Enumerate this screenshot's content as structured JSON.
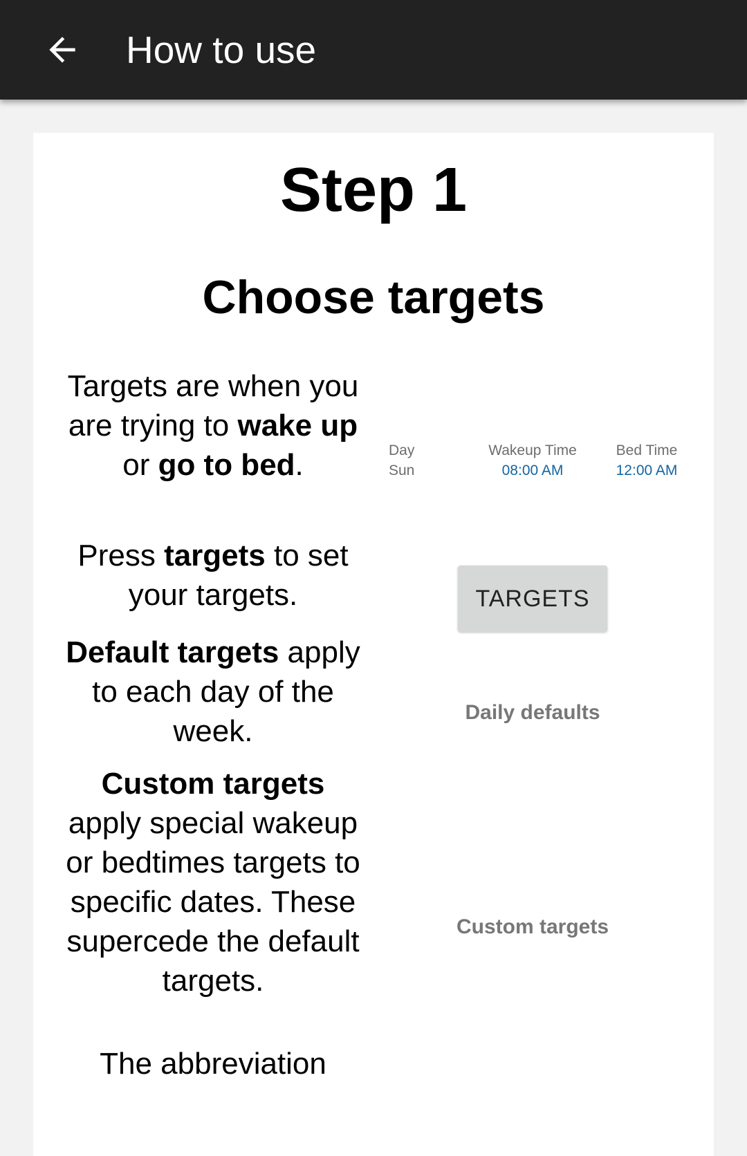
{
  "toolbar": {
    "title": "How to use",
    "back_icon": "arrow-left-icon"
  },
  "step": {
    "title": "Step 1",
    "subtitle": "Choose targets"
  },
  "paragraphs": {
    "p1": {
      "a": "Targets are when you are trying to ",
      "b1": "wake up",
      "c": " or ",
      "b2": "go to bed",
      "d": "."
    },
    "p2": {
      "a": "Press ",
      "b": "targets",
      "c": " to set your targets."
    },
    "p3": {
      "b": "Default targets",
      "c": " apply to each day of the week."
    },
    "p4": {
      "b": "Custom targets",
      "c": " apply special wakeup or bedtimes targets to specific dates. These supercede the default targets."
    },
    "p5": {
      "a": "The abbreviation"
    }
  },
  "preview": {
    "day_label": "Day",
    "day_value": "Sun",
    "wake_label": "Wakeup Time",
    "wake_value": "08:00 AM",
    "bed_label": "Bed Time",
    "bed_value": "12:00 AM",
    "targets_button": "TARGETS",
    "daily_defaults": "Daily defaults",
    "custom_targets": "Custom targets"
  },
  "colors": {
    "appbar": "#222222",
    "time_value": "#1565a0",
    "button_bg": "#d6d7d7"
  }
}
